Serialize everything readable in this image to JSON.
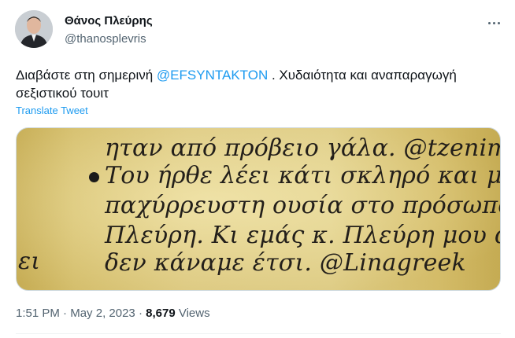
{
  "author": {
    "name": "Θάνος Πλεύρης",
    "handle": "@thanosplevris"
  },
  "tweet": {
    "text_before": "Διαβάστε στη σημερινή ",
    "mention": "@EFSYNTAKTON",
    "text_after": " .  Χυδαιότητα και αναπαραγωγή σεξιστικού τουιτ",
    "translate_label": "Translate Tweet"
  },
  "media": {
    "lines": [
      "ηταν από πρόβειο γάλα. @tzenimpotsi_",
      "Του ήρθε λέει κάτι σκληρό και μια",
      "παχύρρευστη ουσία στο πρόσωπο του",
      "Πλεύρη. Κι εμάς κ. Πλεύρη μου αλλά",
      "δεν κάναμε έτσι.       @Linagreek",
      "ει"
    ]
  },
  "meta": {
    "time": "1:51 PM",
    "sep1": " · ",
    "date": "May 2, 2023",
    "sep2": " · ",
    "views_count": "8,679",
    "views_label": " Views"
  },
  "icons": {
    "more": "more-horizontal-icon"
  }
}
